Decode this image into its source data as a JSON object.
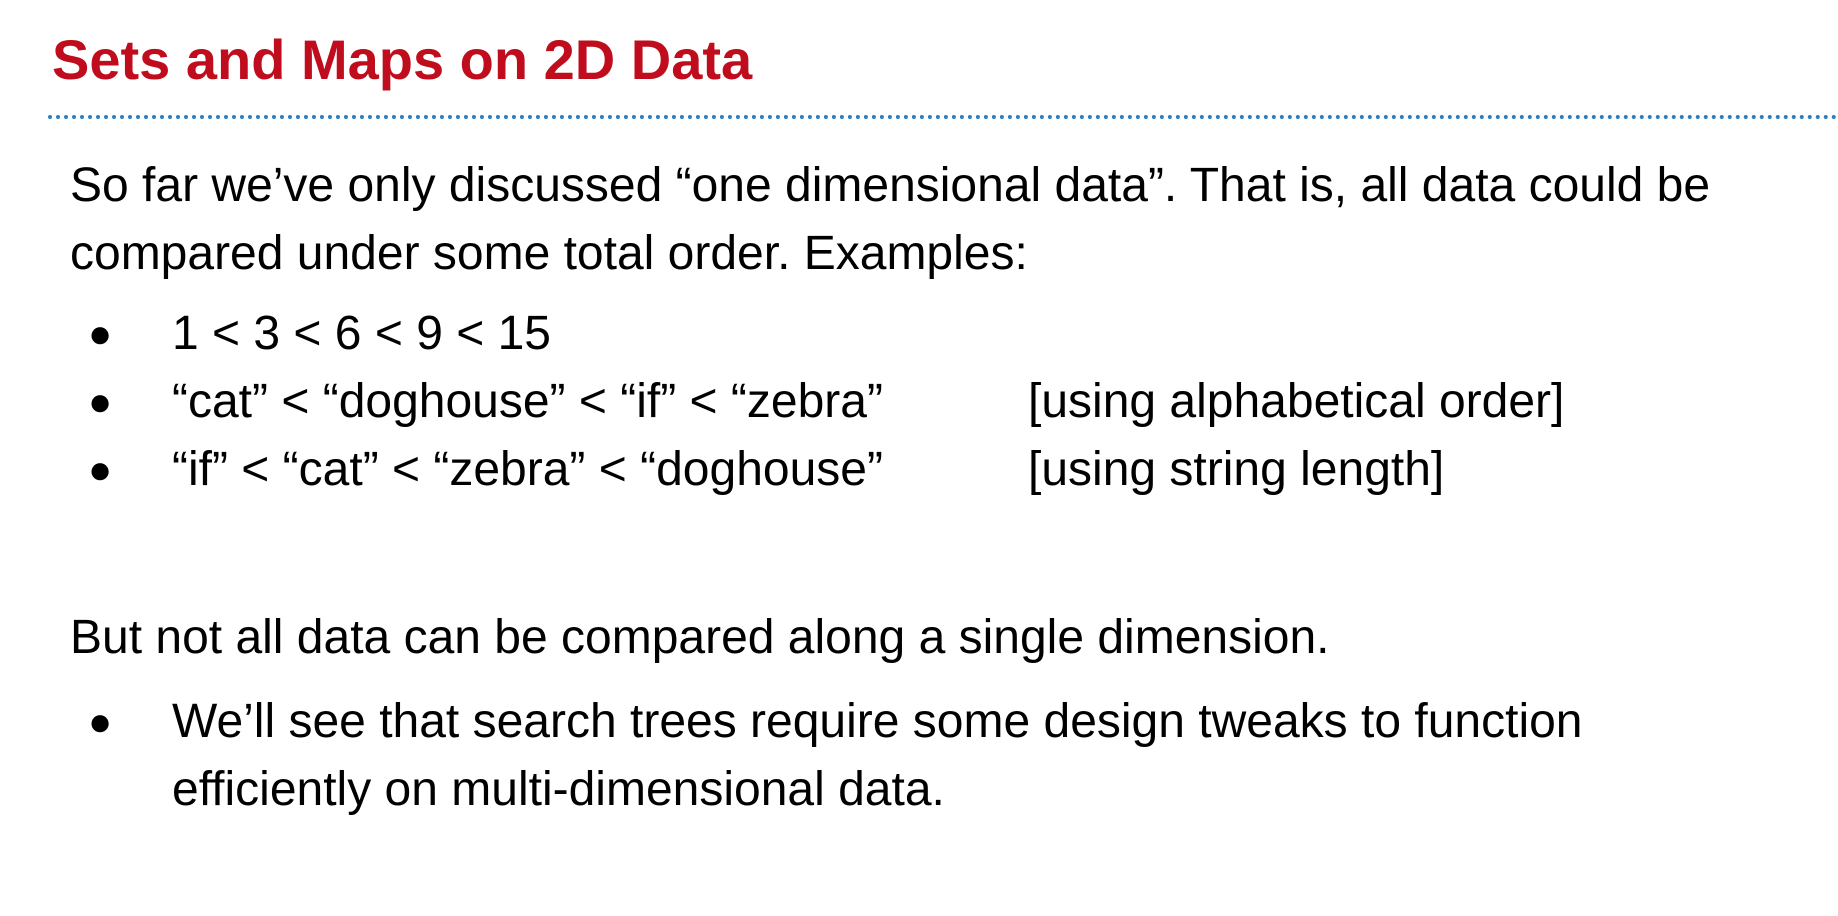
{
  "slide": {
    "title": "Sets and Maps on 2D Data",
    "title_color": "#c00d1e",
    "rule_color": "#2f7fbf",
    "intro_line_1": "So far we’ve only discussed “one dimensional data”. That is, all data could be",
    "intro_line_2": "compared under some total order. Examples:",
    "examples": [
      {
        "text": "1 < 3 < 6 < 9 < 15",
        "note": ""
      },
      {
        "text": "“cat” < “doghouse” < “if” < “zebra”",
        "note": "[using alphabetical order]"
      },
      {
        "text": "“if” < “cat” < “zebra” < “doghouse”",
        "note": "[using string length]"
      }
    ],
    "second_paragraph": "But not all data can be compared along a single dimension.",
    "second_bullet_line_1": "We’ll see that search trees require some design tweaks to function",
    "second_bullet_line_2": "efficiently on multi-dimensional data.",
    "bullet_glyph": "●"
  }
}
